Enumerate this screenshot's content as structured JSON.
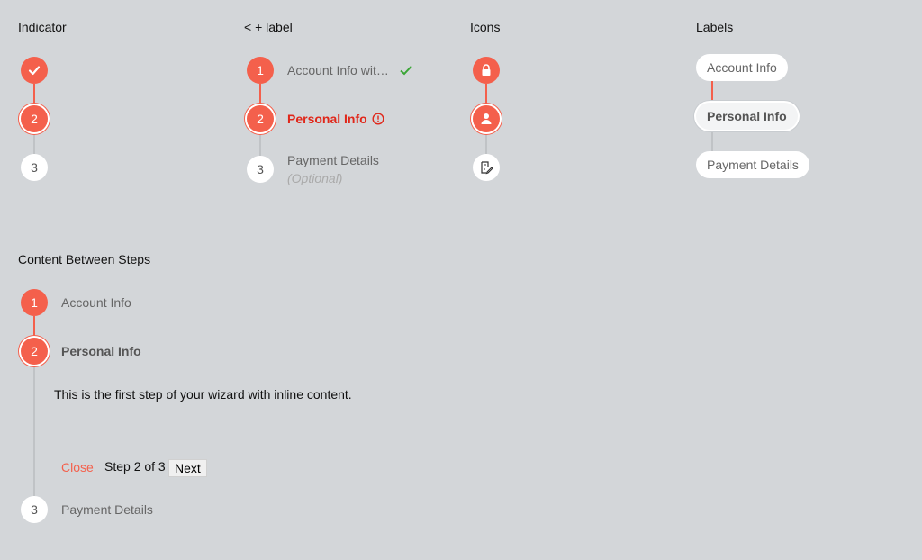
{
  "headings": {
    "indicator": "Indicator",
    "label": "< + label",
    "icons": "Icons",
    "labels": "Labels",
    "content": "Content Between Steps"
  },
  "indicator": {
    "steps": [
      "",
      "2",
      "3"
    ]
  },
  "labelSection": {
    "steps": [
      {
        "number": "1",
        "label": "Account Info wit…"
      },
      {
        "number": "2",
        "label": "Personal Info"
      },
      {
        "number": "3",
        "label": "Payment Details",
        "sub": "(Optional)"
      }
    ]
  },
  "iconSteps": [
    {
      "icon": "lock-icon"
    },
    {
      "icon": "person-icon"
    },
    {
      "icon": "document-edit-icon"
    }
  ],
  "pills": [
    "Account Info",
    "Personal Info",
    "Payment Details"
  ],
  "content": {
    "steps": [
      {
        "number": "1",
        "label": "Account Info"
      },
      {
        "number": "2",
        "label": "Personal Info"
      },
      {
        "number": "3",
        "label": "Payment Details"
      }
    ],
    "body": "This is the first step of your wizard with inline content.",
    "close": "Close",
    "progress": "Step 2 of 3",
    "next": "Next"
  },
  "colors": {
    "accent": "#f4604c",
    "error": "#e0271a",
    "success": "#3aa636",
    "background": "#d3d6d9"
  }
}
